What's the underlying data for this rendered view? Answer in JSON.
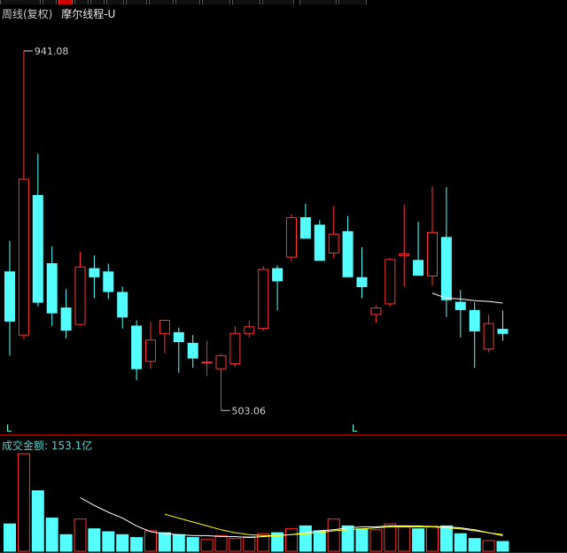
{
  "header": {
    "period_label": "周线(复权)",
    "indicator_label": "摩尔线程-U"
  },
  "volume_header": {
    "label": "成交金额:",
    "value": "153.1亿"
  },
  "markers": [
    "L",
    "L"
  ],
  "colors": {
    "up": "#ff3232",
    "down": "#54ffff",
    "ma_white": "#ffffff",
    "ma_yellow": "#ffff00",
    "border": "#8b0000"
  },
  "chart_data": [
    {
      "type": "candlestick",
      "title": "周线(复权)",
      "series_name": "摩尔线程-U",
      "ylim": [
        485,
        960
      ],
      "annotations": [
        {
          "text": "941.08",
          "candle": 1,
          "value": 941.08,
          "kind": "high"
        },
        {
          "text": "503.06",
          "candle": 15,
          "value": 503.06,
          "kind": "low"
        }
      ],
      "candles": [
        {
          "o": 672,
          "h": 710,
          "l": 570,
          "c": 612
        },
        {
          "o": 595,
          "h": 941.08,
          "l": 590,
          "c": 785
        },
        {
          "o": 765,
          "h": 816,
          "l": 630,
          "c": 635
        },
        {
          "o": 682,
          "h": 703,
          "l": 606,
          "c": 622
        },
        {
          "o": 628,
          "h": 651,
          "l": 591,
          "c": 601
        },
        {
          "o": 608,
          "h": 696,
          "l": 607,
          "c": 678
        },
        {
          "o": 676,
          "h": 692,
          "l": 640,
          "c": 666
        },
        {
          "o": 672,
          "h": 682,
          "l": 639,
          "c": 648
        },
        {
          "o": 647,
          "h": 654,
          "l": 603,
          "c": 617
        },
        {
          "o": 606,
          "h": 613,
          "l": 540,
          "c": 554
        },
        {
          "o": 563,
          "h": 611,
          "l": 554,
          "c": 589
        },
        {
          "o": 597,
          "h": 612,
          "l": 573,
          "c": 613
        },
        {
          "o": 598,
          "h": 604,
          "l": 549,
          "c": 587
        },
        {
          "o": 585,
          "h": 595,
          "l": 555,
          "c": 567
        },
        {
          "o": 562,
          "h": 588,
          "l": 545,
          "c": 562
        },
        {
          "o": 554,
          "h": 572,
          "l": 503.06,
          "c": 570
        },
        {
          "o": 560,
          "h": 606,
          "l": 556,
          "c": 597
        },
        {
          "o": 597,
          "h": 613,
          "l": 592,
          "c": 605
        },
        {
          "o": 603,
          "h": 679,
          "l": 600,
          "c": 675
        },
        {
          "o": 676,
          "h": 680,
          "l": 625,
          "c": 661
        },
        {
          "o": 690,
          "h": 742,
          "l": 685,
          "c": 738
        },
        {
          "o": 738,
          "h": 755,
          "l": 722,
          "c": 713
        },
        {
          "o": 729,
          "h": 735,
          "l": 686,
          "c": 686
        },
        {
          "o": 695,
          "h": 752,
          "l": 689,
          "c": 718
        },
        {
          "o": 721,
          "h": 740,
          "l": 666,
          "c": 666
        },
        {
          "o": 665,
          "h": 702,
          "l": 640,
          "c": 654
        },
        {
          "o": 620,
          "h": 631,
          "l": 610,
          "c": 628
        },
        {
          "o": 633,
          "h": 689,
          "l": 630,
          "c": 687
        },
        {
          "o": 692,
          "h": 754,
          "l": 654,
          "c": 694
        },
        {
          "o": 686,
          "h": 733,
          "l": 669,
          "c": 668
        },
        {
          "o": 667,
          "h": 776,
          "l": 655,
          "c": 720
        },
        {
          "o": 714,
          "h": 775,
          "l": 617,
          "c": 638
        },
        {
          "o": 635,
          "h": 650,
          "l": 592,
          "c": 626
        },
        {
          "o": 625,
          "h": 635,
          "l": 555,
          "c": 600
        },
        {
          "o": 578,
          "h": 620,
          "l": 574,
          "c": 609
        },
        {
          "o": 602,
          "h": 625,
          "l": 588,
          "c": 597
        }
      ],
      "ma_white": [
        null,
        null,
        null,
        null,
        null,
        null,
        null,
        null,
        null,
        null,
        null,
        null,
        null,
        null,
        null,
        null,
        null,
        null,
        null,
        null,
        null,
        null,
        null,
        null,
        null,
        null,
        null,
        null,
        null,
        null,
        646,
        640,
        639,
        637,
        636,
        634
      ]
    },
    {
      "type": "bar",
      "title": "成交金额",
      "ylim": [
        0,
        100
      ],
      "values": [
        28,
        100,
        62,
        34,
        17,
        33,
        23,
        20,
        17,
        14,
        21,
        19,
        17,
        14,
        12,
        16,
        13,
        15,
        18,
        19,
        23,
        26,
        21,
        33,
        26,
        23,
        22,
        28,
        26,
        23,
        26,
        26,
        18,
        13,
        11,
        10
      ],
      "up_down": [
        "d",
        "u",
        "d",
        "d",
        "d",
        "u",
        "d",
        "d",
        "d",
        "d",
        "u",
        "d",
        "d",
        "d",
        "u",
        "u",
        "u",
        "u",
        "u",
        "d",
        "u",
        "d",
        "d",
        "u",
        "d",
        "d",
        "u",
        "u",
        "u",
        "d",
        "u",
        "d",
        "d",
        "d",
        "u",
        "d"
      ],
      "ma_white": [
        null,
        null,
        null,
        null,
        null,
        null,
        null,
        null,
        null,
        null,
        null,
        null,
        null,
        null,
        null,
        null,
        null,
        null,
        null,
        null,
        null,
        null,
        null,
        null,
        null,
        null,
        null,
        null,
        null,
        null,
        null,
        null,
        null,
        null,
        null,
        null
      ],
      "ma_white_vals": [
        null,
        null,
        null,
        null,
        null,
        55,
        47,
        40,
        34,
        26,
        20,
        18,
        17,
        16,
        16,
        15,
        15,
        14,
        15,
        16,
        17,
        19,
        21,
        22,
        24,
        25,
        25,
        26,
        26,
        26,
        25,
        25,
        24,
        22,
        19,
        16
      ],
      "ma_yellow_vals": [
        null,
        null,
        null,
        null,
        null,
        null,
        null,
        null,
        null,
        null,
        null,
        38,
        34,
        30,
        26,
        22,
        19,
        17,
        16,
        16,
        17,
        18,
        19,
        21,
        22,
        23,
        24,
        25,
        25,
        25,
        25,
        24,
        23,
        21,
        19,
        17
      ]
    }
  ]
}
